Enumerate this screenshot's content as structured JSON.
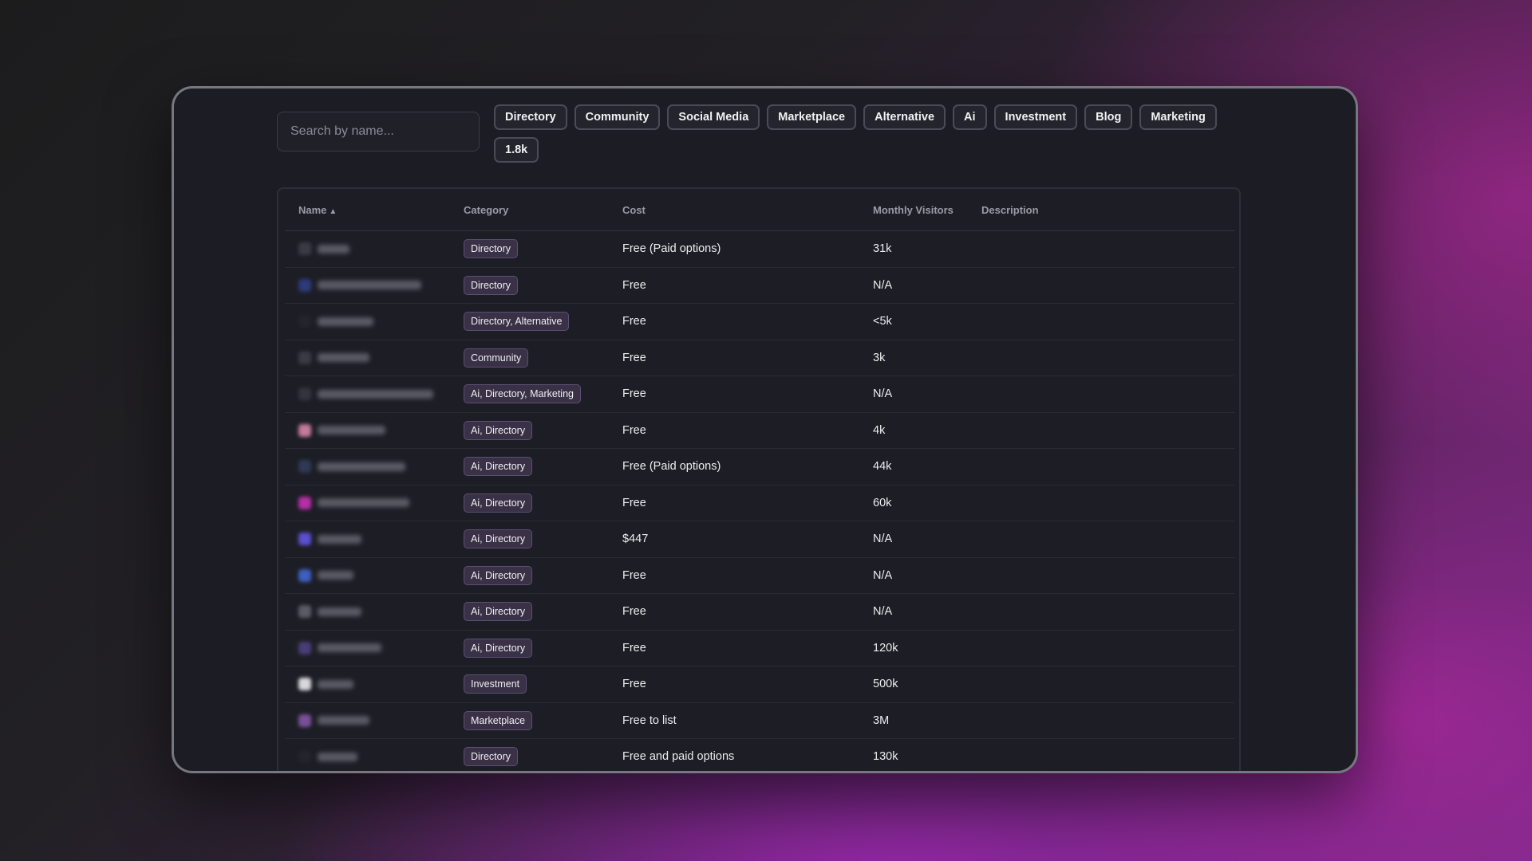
{
  "search": {
    "placeholder": "Search by name..."
  },
  "filters": [
    "Directory",
    "Community",
    "Social Media",
    "Marketplace",
    "Alternative",
    "Ai",
    "Investment",
    "Blog",
    "Marketing",
    "1.8k"
  ],
  "table": {
    "headers": {
      "name": "Name",
      "sort_icon": "▲",
      "category": "Category",
      "cost": "Cost",
      "visitors": "Monthly Visitors",
      "description": "Description"
    },
    "rows": [
      {
        "category": "Directory",
        "cost": "Free (Paid options)",
        "visitors": "31k",
        "avatar_color": "#3a3b44"
      },
      {
        "category": "Directory",
        "cost": "Free",
        "visitors": "N/A",
        "avatar_color": "#2e3a7a"
      },
      {
        "category": "Directory, Alternative",
        "cost": "Free",
        "visitors": "<5k",
        "avatar_color": "#23242c"
      },
      {
        "category": "Community",
        "cost": "Free",
        "visitors": "3k",
        "avatar_color": "#3a3b44"
      },
      {
        "category": "Ai, Directory, Marketing",
        "cost": "Free",
        "visitors": "N/A",
        "avatar_color": "#33343d"
      },
      {
        "category": "Ai, Directory",
        "cost": "Free",
        "visitors": "4k",
        "avatar_color": "#c47a9a"
      },
      {
        "category": "Ai, Directory",
        "cost": "Free (Paid options)",
        "visitors": "44k",
        "avatar_color": "#2e3a55"
      },
      {
        "category": "Ai, Directory",
        "cost": "Free",
        "visitors": "60k",
        "avatar_color": "#b52fa8"
      },
      {
        "category": "Ai, Directory",
        "cost": "$447",
        "visitors": "N/A",
        "avatar_color": "#5a4fd0"
      },
      {
        "category": "Ai, Directory",
        "cost": "Free",
        "visitors": "N/A",
        "avatar_color": "#3d5fc0"
      },
      {
        "category": "Ai, Directory",
        "cost": "Free",
        "visitors": "N/A",
        "avatar_color": "#5a5b64"
      },
      {
        "category": "Ai, Directory",
        "cost": "Free",
        "visitors": "120k",
        "avatar_color": "#4a3d78"
      },
      {
        "category": "Investment",
        "cost": "Free",
        "visitors": "500k",
        "avatar_color": "#d8d8dc"
      },
      {
        "category": "Marketplace",
        "cost": "Free to list",
        "visitors": "3M",
        "avatar_color": "#7a4f9a"
      },
      {
        "category": "Directory",
        "cost": "Free and paid options",
        "visitors": "130k",
        "avatar_color": "#23242c"
      }
    ]
  }
}
